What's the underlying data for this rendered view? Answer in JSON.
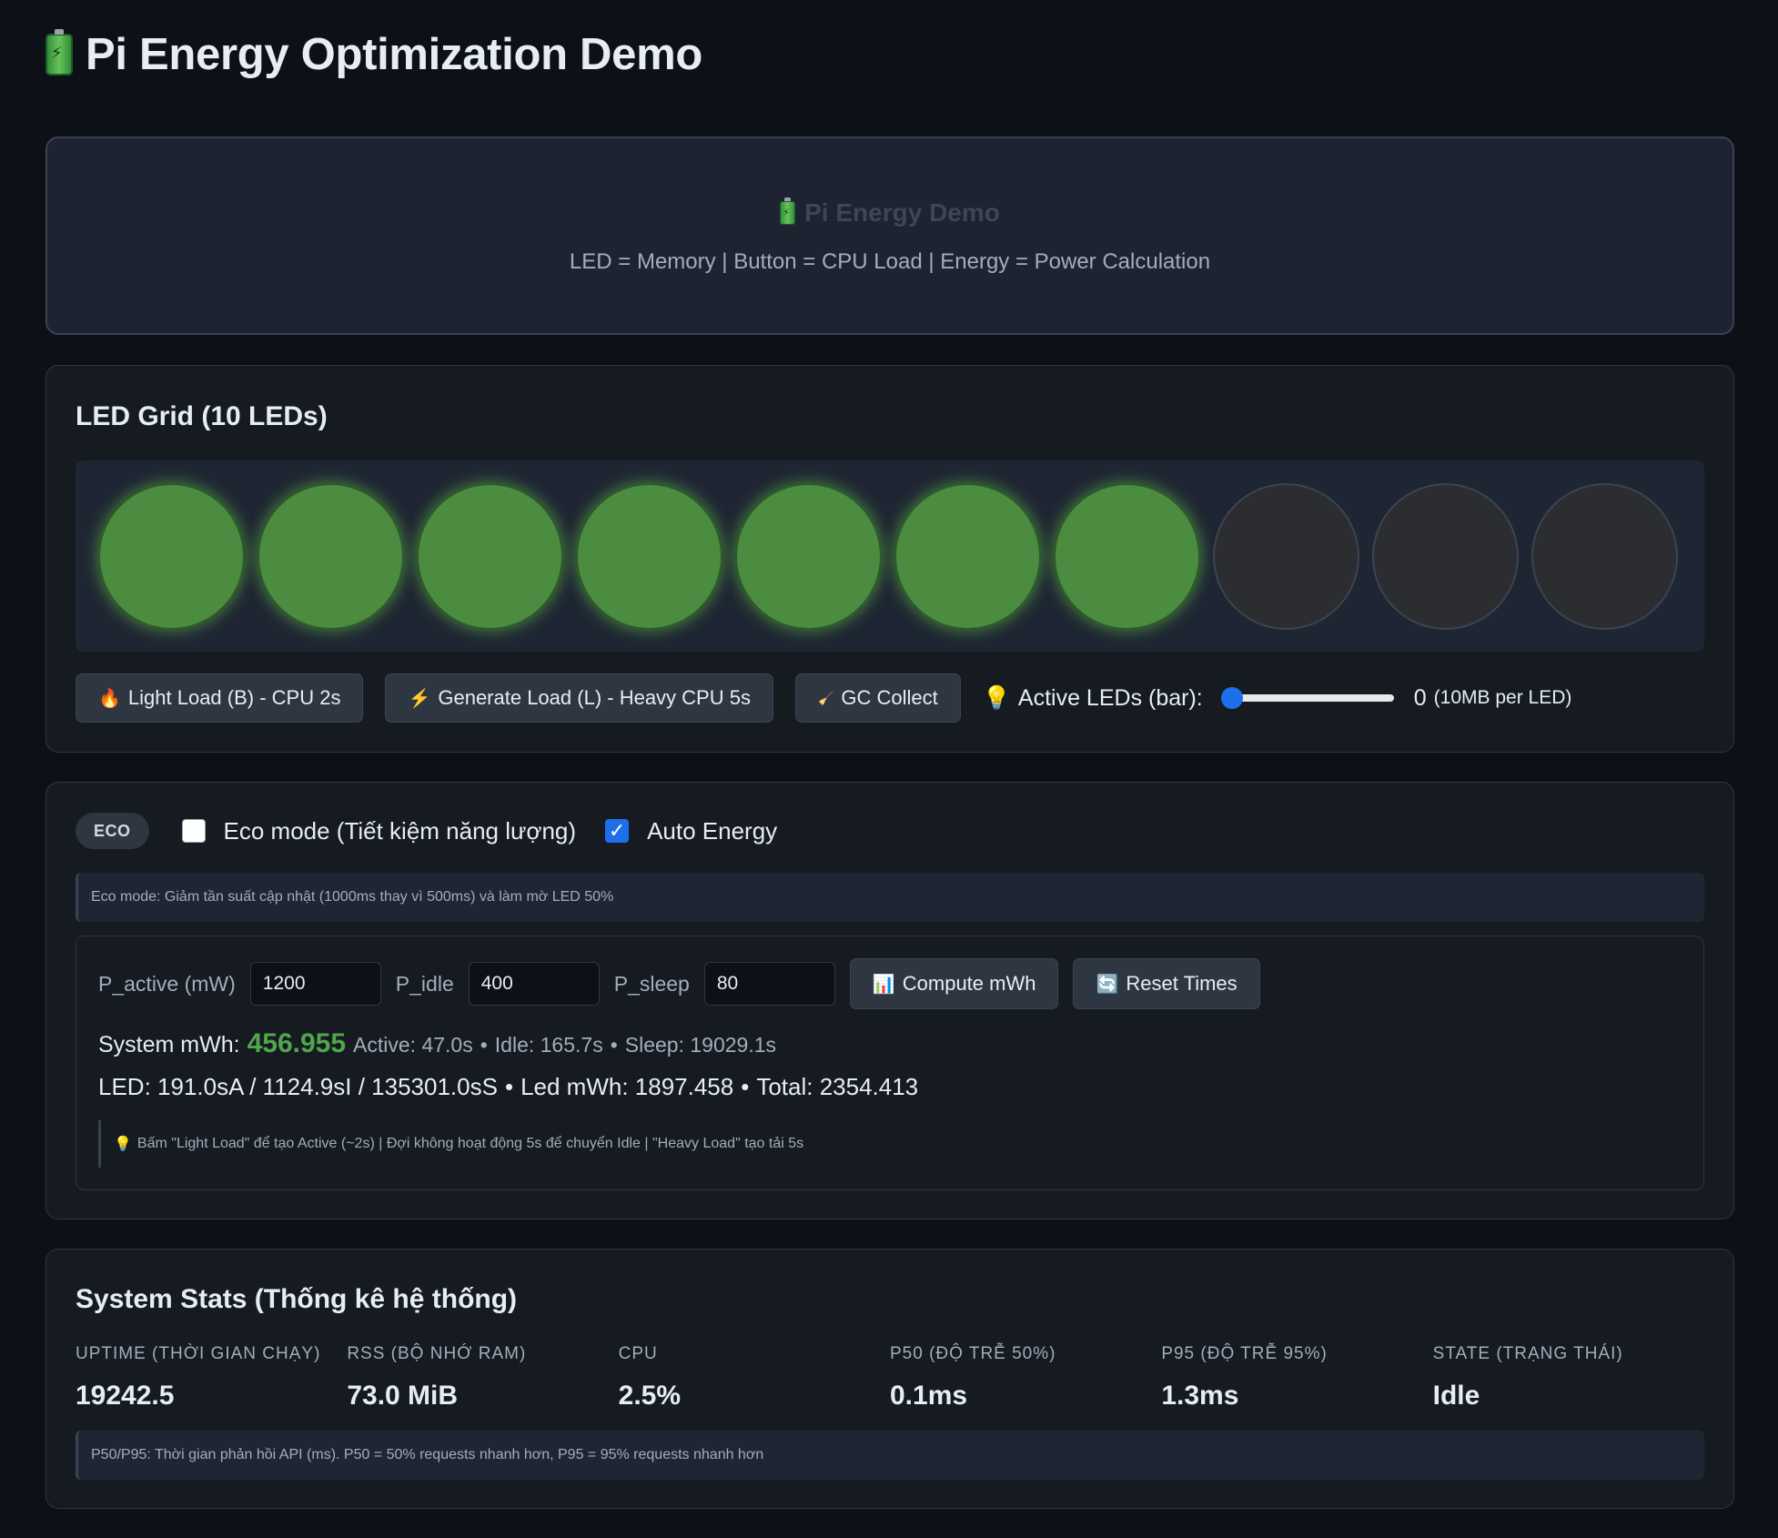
{
  "page": {
    "title": "Pi Energy Optimization Demo",
    "title_icon": "battery-icon"
  },
  "hero": {
    "title": "Pi Energy Demo",
    "subtitle": "LED = Memory | Button = CPU Load | Energy = Power Calculation"
  },
  "led_grid": {
    "heading": "LED Grid (10 LEDs)",
    "leds": [
      true,
      true,
      true,
      true,
      true,
      true,
      true,
      false,
      false,
      false
    ],
    "colors": {
      "on": "#4b8c41",
      "off": "#2b2d31"
    },
    "buttons": {
      "light_load": "Light Load (B) - CPU 2s",
      "light_load_icon": "🔥",
      "heavy_load": "Generate Load (L) - Heavy CPU 5s",
      "heavy_load_icon": "⚡",
      "gc_collect": "GC Collect",
      "gc_collect_icon": "🧹"
    },
    "slider": {
      "label": "Active LEDs (bar):",
      "icon": "💡",
      "value": "0",
      "fraction": 0,
      "unit": "(10MB per LED)"
    }
  },
  "eco": {
    "badge": "ECO",
    "eco_mode_label": "Eco mode (Tiết kiệm năng lượng)",
    "eco_mode_checked": false,
    "auto_energy_label": "Auto Energy",
    "auto_energy_checked": true,
    "note": "Eco mode: Giảm tần suất cập nhật (1000ms thay vì 500ms) và làm mờ LED 50%"
  },
  "energy": {
    "p_active_label": "P_active (mW)",
    "p_active_value": "1200",
    "p_idle_label": "P_idle",
    "p_idle_value": "400",
    "p_sleep_label": "P_sleep",
    "p_sleep_value": "80",
    "compute_button": "Compute mWh",
    "compute_icon": "📊",
    "reset_button": "Reset Times",
    "reset_icon": "🔄",
    "system_label": "System mWh:",
    "system_value": "456.955",
    "active": "Active: 47.0s",
    "idle": "Idle: 165.7s",
    "sleep": "Sleep: 19029.1s",
    "led_line": "LED: 191.0sA / 1124.9sI / 135301.0sS",
    "led_mwh": "Led mWh: 1897.458",
    "total": "Total: 2354.413",
    "hint_icon": "💡",
    "hint": "Bấm \"Light Load\" để tạo Active (~2s) | Đợi không hoạt động 5s để chuyển Idle | \"Heavy Load\" tạo tải 5s"
  },
  "stats": {
    "heading": "System Stats (Thống kê hệ thống)",
    "items": [
      {
        "label": "UPTIME (THỜI GIAN CHẠY)",
        "value": "19242.5"
      },
      {
        "label": "RSS (BỘ NHỚ RAM)",
        "value": "73.0 MiB"
      },
      {
        "label": "CPU",
        "value": "2.5%"
      },
      {
        "label": "P50 (ĐỘ TRỄ 50%)",
        "value": "0.1ms"
      },
      {
        "label": "P95 (ĐỘ TRỄ 95%)",
        "value": "1.3ms"
      },
      {
        "label": "STATE (TRẠNG THÁI)",
        "value": "Idle"
      }
    ],
    "note": "P50/P95: Thời gian phản hồi API (ms). P50 = 50% requests nhanh hơn, P95 = 95% requests nhanh hơn"
  }
}
